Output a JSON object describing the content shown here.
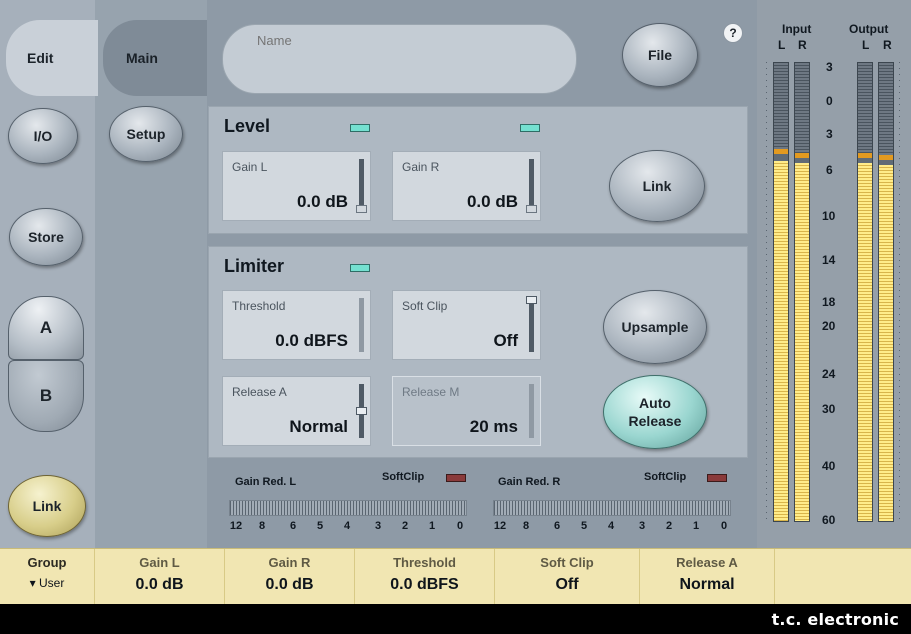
{
  "nav": {
    "edit": "Edit",
    "main": "Main",
    "io": "I/O",
    "setup": "Setup",
    "store": "Store",
    "a": "A",
    "b": "B",
    "link": "Link"
  },
  "header": {
    "name_placeholder": "Name",
    "file": "File",
    "help": "?"
  },
  "level": {
    "title": "Level",
    "gain_l": {
      "label": "Gain L",
      "value": "0.0 dB"
    },
    "gain_r": {
      "label": "Gain R",
      "value": "0.0 dB"
    },
    "link": "Link"
  },
  "limiter": {
    "title": "Limiter",
    "threshold": {
      "label": "Threshold",
      "value": "0.0 dBFS"
    },
    "soft_clip": {
      "label": "Soft Clip",
      "value": "Off"
    },
    "release_a": {
      "label": "Release A",
      "value": "Normal"
    },
    "release_m": {
      "label": "Release M",
      "value": "20 ms"
    },
    "upsample": "Upsample",
    "auto_release_1": "Auto",
    "auto_release_2": "Release"
  },
  "gain_reduction": {
    "left_label": "Gain Red. L",
    "right_label": "Gain Red. R",
    "softclip_label": "SoftClip",
    "ticks": [
      "12",
      "8",
      "6",
      "5",
      "4",
      "3",
      "2",
      "1",
      "0"
    ]
  },
  "meters": {
    "input_label": "Input",
    "output_label": "Output",
    "l": "L",
    "r": "R",
    "scale": [
      "3",
      "0",
      "3",
      "6",
      "10",
      "14",
      "18",
      "20",
      "24",
      "30",
      "40",
      "60"
    ],
    "colors": {
      "fill": "#ffec8a",
      "hold": "#e39a20"
    }
  },
  "strip": {
    "group_label": "Group",
    "group_value": "▾ User",
    "items": [
      {
        "label": "Gain L",
        "value": "0.0 dB"
      },
      {
        "label": "Gain R",
        "value": "0.0 dB"
      },
      {
        "label": "Threshold",
        "value": "0.0 dBFS"
      },
      {
        "label": "Soft Clip",
        "value": "Off"
      },
      {
        "label": "Release A",
        "value": "Normal"
      }
    ]
  },
  "brand": "t.c. electronic"
}
